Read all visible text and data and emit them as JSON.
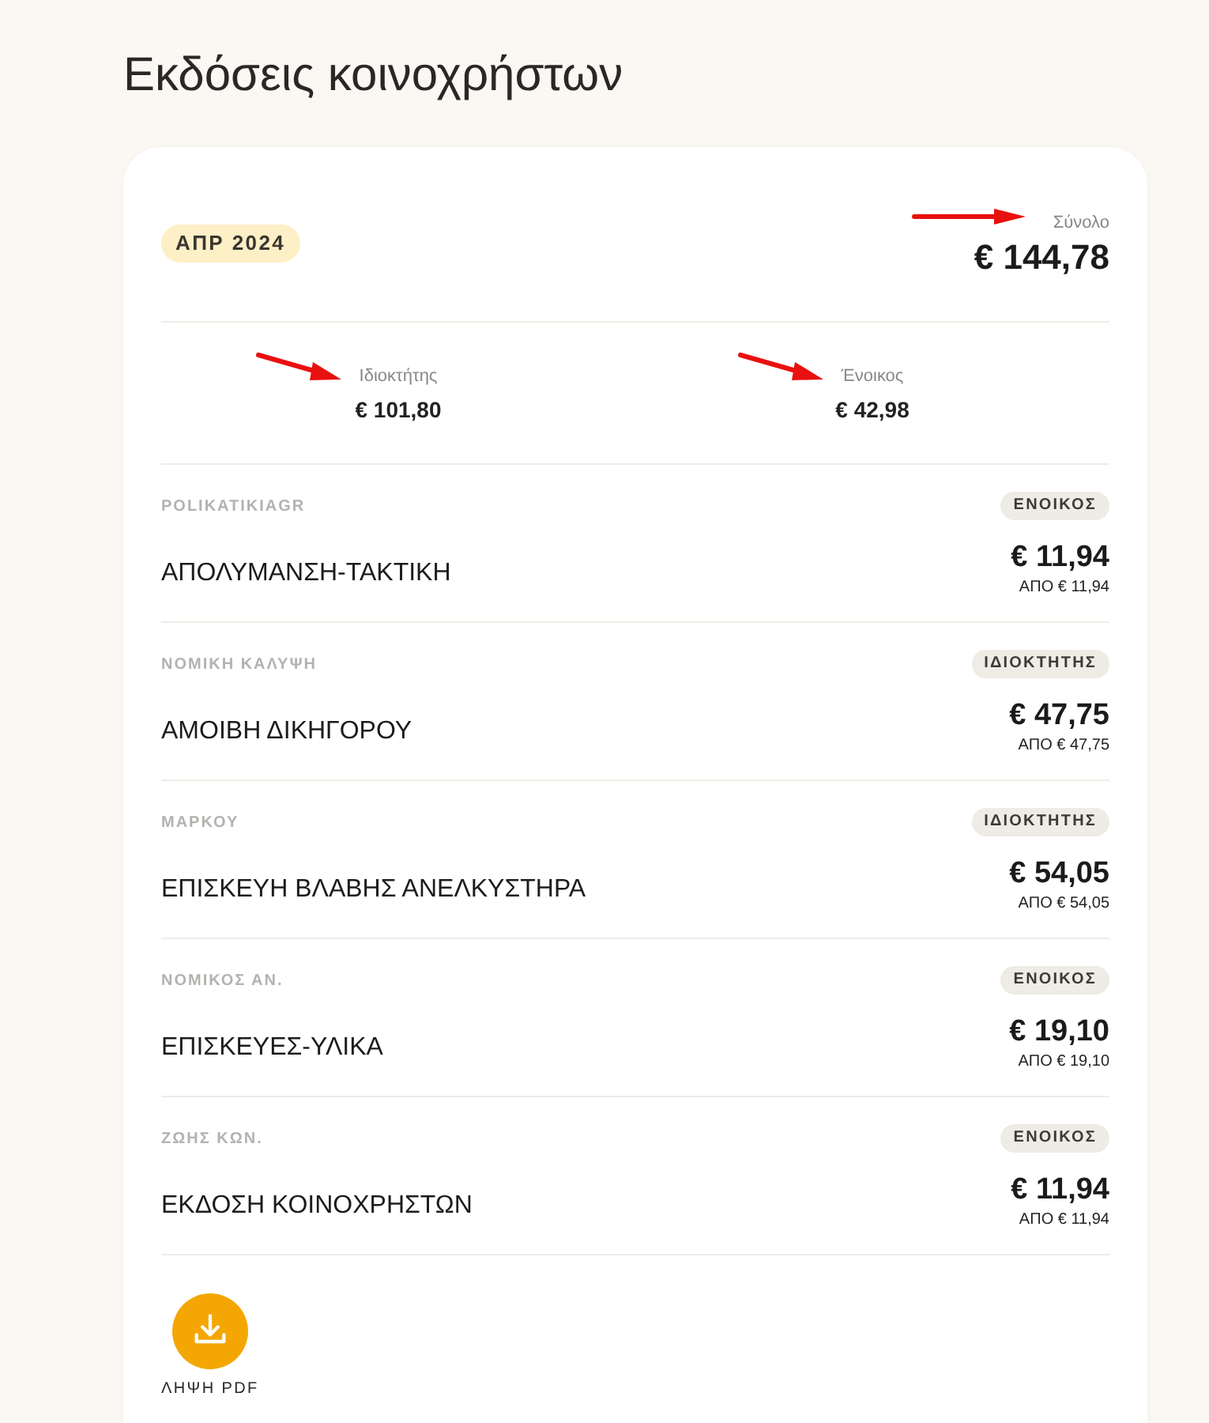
{
  "page": {
    "title": "Εκδόσεις κοινοχρήστων"
  },
  "summary": {
    "period": "ΑΠΡ 2024",
    "total_label": "Σύνολο",
    "total": "€ 144,78",
    "total_pointer_arrow": true,
    "split": [
      {
        "label": "Ιδιοκτήτης",
        "amount": "€ 101,80",
        "pointer_arrow": true
      },
      {
        "label": "Ένοικος",
        "amount": "€ 42,98",
        "pointer_arrow": true
      }
    ]
  },
  "expenses": [
    {
      "category": "POLIKATIKIAGR",
      "tag": "ΕΝΟΙΚΟΣ",
      "title": "ΑΠΟΛΥΜΑΝΣΗ-ΤΑΚΤΙΚΗ",
      "amount": "€ 11,94",
      "from": "ΑΠΟ € 11,94"
    },
    {
      "category": "ΝΟΜΙΚΗ ΚΑΛΥΨΗ",
      "tag": "ΙΔΙΟΚΤΗΤΗΣ",
      "title": "ΑΜΟΙΒΗ ΔΙΚΗΓΟΡΟΥ",
      "amount": "€ 47,75",
      "from": "ΑΠΟ € 47,75"
    },
    {
      "category": "ΜΑΡΚΟΥ",
      "tag": "ΙΔΙΟΚΤΗΤΗΣ",
      "title": "ΕΠΙΣΚΕΥΗ ΒΛΑΒΗΣ ΑΝΕΛΚΥΣΤΗΡΑ",
      "amount": "€ 54,05",
      "from": "ΑΠΟ € 54,05"
    },
    {
      "category": "ΝΟΜΙΚΟΣ ΑΝ.",
      "tag": "ΕΝΟΙΚΟΣ",
      "title": "ΕΠΙΣΚΕΥΕΣ-ΥΛΙΚΑ",
      "amount": "€ 19,10",
      "from": "ΑΠΟ € 19,10"
    },
    {
      "category": "ΖΩΗΣ ΚΩΝ.",
      "tag": "ΕΝΟΙΚΟΣ",
      "title": "ΕΚΔΟΣΗ ΚΟΙΝΟΧΡΗΣΤΩΝ",
      "amount": "€ 11,94",
      "from": "ΑΠΟ € 11,94"
    }
  ],
  "download": {
    "label": "ΛΗΨΗ PDF"
  }
}
